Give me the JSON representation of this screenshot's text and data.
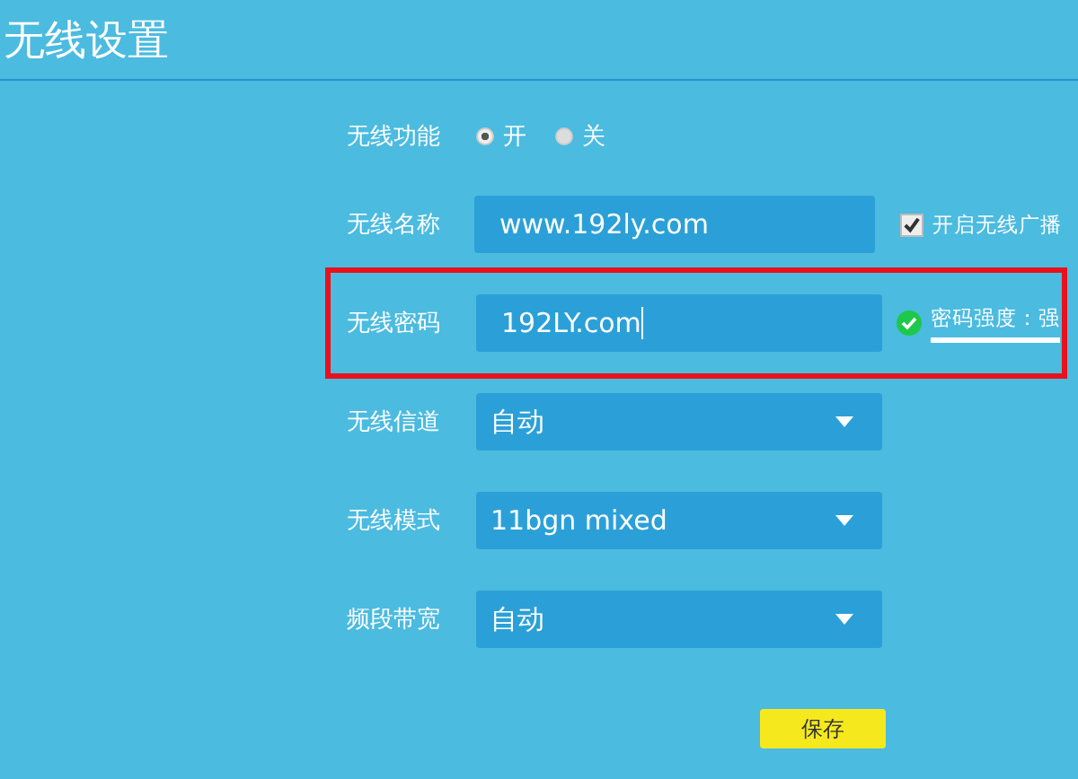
{
  "title": "无线设置",
  "rows": [
    {
      "label": "无线功能",
      "kind": "radio",
      "options": [
        {
          "label": "开",
          "selected": true
        },
        {
          "label": "关",
          "selected": false
        }
      ]
    },
    {
      "label": "无线名称",
      "kind": "text",
      "value": "www.192ly.com",
      "focused": false,
      "highlighted": false,
      "checkbox": {
        "label": "开启无线广播",
        "checked": true
      }
    },
    {
      "label": "无线密码",
      "kind": "text",
      "value": "192LY.com",
      "focused": true,
      "highlighted": true,
      "strength": "密码强度：强"
    },
    {
      "label": "无线信道",
      "kind": "select",
      "value": "自动"
    },
    {
      "label": "无线模式",
      "kind": "select",
      "value": "11bgn mixed"
    },
    {
      "label": "频段带宽",
      "kind": "select",
      "value": "自动"
    }
  ],
  "save_button": "保存"
}
